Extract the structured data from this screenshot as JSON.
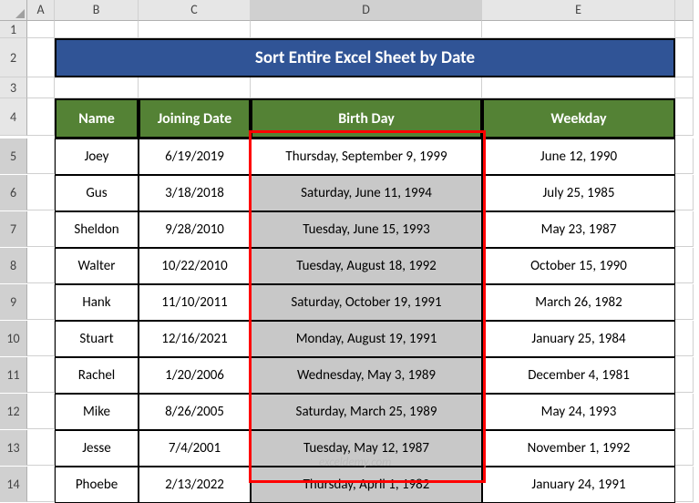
{
  "columns": [
    "A",
    "B",
    "C",
    "D",
    "E"
  ],
  "title": "Sort Entire Excel Sheet by Date",
  "headers": {
    "name": "Name",
    "joining": "Joining Date",
    "birthday": "Birth Day",
    "weekday": "Weekday"
  },
  "rows_label": [
    "1",
    "2",
    "3",
    "4",
    "5",
    "6",
    "7",
    "8",
    "9",
    "10",
    "11",
    "12",
    "13",
    "14"
  ],
  "watermark": "exceldemy.com",
  "chart_data": {
    "type": "table",
    "columns": [
      "Name",
      "Joining Date",
      "Birth Day",
      "Weekday"
    ],
    "rows": [
      {
        "name": "Joey",
        "joining": "6/19/2019",
        "birthday": "Thursday, September 9, 1999",
        "weekday": "June 12, 1990"
      },
      {
        "name": "Gus",
        "joining": "3/18/2018",
        "birthday": "Saturday, June 11, 1994",
        "weekday": "July 25, 1985"
      },
      {
        "name": "Sheldon",
        "joining": "9/28/2010",
        "birthday": "Tuesday, June 15, 1993",
        "weekday": "May 23, 1987"
      },
      {
        "name": "Walter",
        "joining": "10/22/2010",
        "birthday": "Tuesday, August 18, 1992",
        "weekday": "October 15, 1990"
      },
      {
        "name": "Hank",
        "joining": "11/10/2011",
        "birthday": "Saturday, October 19, 1991",
        "weekday": "March 26, 1982"
      },
      {
        "name": "Stuart",
        "joining": "12/16/2021",
        "birthday": "Monday, August 19, 1991",
        "weekday": "January 25, 1984"
      },
      {
        "name": "Rachel",
        "joining": "1/20/2006",
        "birthday": "Wednesday, May 3, 1989",
        "weekday": "December 4, 1981"
      },
      {
        "name": "Mike",
        "joining": "8/26/2005",
        "birthday": "Saturday, March 25, 1989",
        "weekday": "May 24, 1993"
      },
      {
        "name": "Jesse",
        "joining": "7/4/2001",
        "birthday": "Tuesday, May 12, 1987",
        "weekday": "November 1, 1992"
      },
      {
        "name": "Phoebe",
        "joining": "2/13/2022",
        "birthday": "Thursday, April 1, 1982",
        "weekday": "January 24, 1991"
      }
    ]
  }
}
